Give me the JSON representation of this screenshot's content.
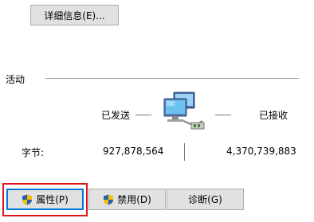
{
  "buttons": {
    "details": "详细信息(E)...",
    "properties": "属性(P)",
    "disable": "禁用(D)",
    "diagnose": "诊断(G)"
  },
  "activity": {
    "section_label": "活动",
    "sent_label": "已发送",
    "received_label": "已接收",
    "bytes_label": "字节:",
    "bytes_sent": "927,878,564",
    "bytes_received": "4,370,739,883"
  },
  "icons": {
    "network": "network-computers-icon",
    "shield": "uac-shield-icon"
  },
  "colors": {
    "highlight": "#e0151b",
    "focus": "#0078d7",
    "button_bg": "#e1e1e1"
  }
}
